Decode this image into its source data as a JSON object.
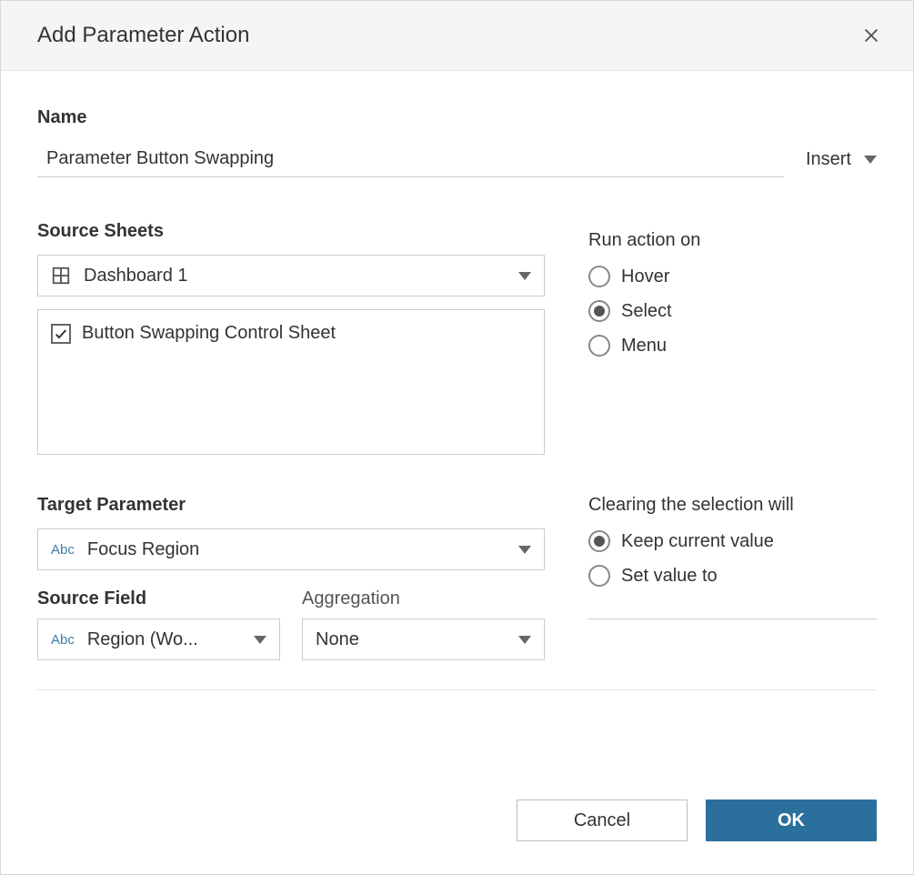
{
  "dialog": {
    "title": "Add Parameter Action"
  },
  "name": {
    "label": "Name",
    "value": "Parameter Button Swapping",
    "insert_label": "Insert"
  },
  "source_sheets": {
    "label": "Source Sheets",
    "dashboard_selected": "Dashboard 1",
    "items": [
      {
        "label": "Button Swapping Control Sheet",
        "checked": true
      }
    ]
  },
  "run_action": {
    "label": "Run action on",
    "options": [
      {
        "label": "Hover",
        "selected": false
      },
      {
        "label": "Select",
        "selected": true
      },
      {
        "label": "Menu",
        "selected": false
      }
    ]
  },
  "target_parameter": {
    "label": "Target Parameter",
    "selected": "Focus Region",
    "icon_text": "Abc"
  },
  "source_field": {
    "label": "Source Field",
    "selected": "Region (Wo...",
    "icon_text": "Abc"
  },
  "aggregation": {
    "label": "Aggregation",
    "selected": "None"
  },
  "clearing": {
    "label": "Clearing the selection will",
    "options": [
      {
        "label": "Keep current value",
        "selected": true
      },
      {
        "label": "Set value to",
        "selected": false
      }
    ]
  },
  "buttons": {
    "cancel": "Cancel",
    "ok": "OK"
  }
}
